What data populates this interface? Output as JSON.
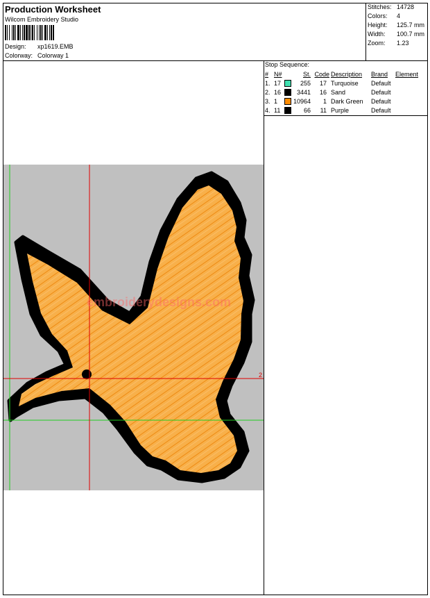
{
  "header": {
    "title": "Production Worksheet",
    "software": "Wilcom  Embroidery Studio",
    "design_label": "Design:",
    "design_value": "xp1619.EMB",
    "colorway_label": "Colorway:",
    "colorway_value": "Colorway 1"
  },
  "stats": [
    {
      "label": "Stitches:",
      "value": "14728"
    },
    {
      "label": "Colors:",
      "value": "4"
    },
    {
      "label": "Height:",
      "value": "125.7 mm"
    },
    {
      "label": "Width:",
      "value": "100.7 mm"
    },
    {
      "label": "Zoom:",
      "value": "1.23"
    }
  ],
  "stop_sequence": {
    "title": "Stop Sequence:",
    "columns": [
      "#",
      "N#",
      "St.",
      "Code",
      "Description",
      "Brand",
      "Element"
    ],
    "rows": [
      {
        "num": "1.",
        "n": "17",
        "color": "#3fe0b0",
        "st": "255",
        "code": "17",
        "desc": "Turquoise",
        "brand": "Default"
      },
      {
        "num": "2.",
        "n": "16",
        "color": "#000000",
        "st": "3441",
        "code": "16",
        "desc": "Sand",
        "brand": "Default"
      },
      {
        "num": "3.",
        "n": "1",
        "color": "#ff8c00",
        "st": "10964",
        "code": "1",
        "desc": "Dark Green",
        "brand": "Default"
      },
      {
        "num": "4.",
        "n": "11",
        "color": "#000000",
        "st": "66",
        "code": "11",
        "desc": "Purple",
        "brand": "Default"
      }
    ]
  },
  "canvas": {
    "watermark": "embroiderydesigns.com",
    "marker_label": "2",
    "background_color": "#c0c0c0",
    "fill_color": "#f7a23a",
    "outline_color": "#000000"
  }
}
